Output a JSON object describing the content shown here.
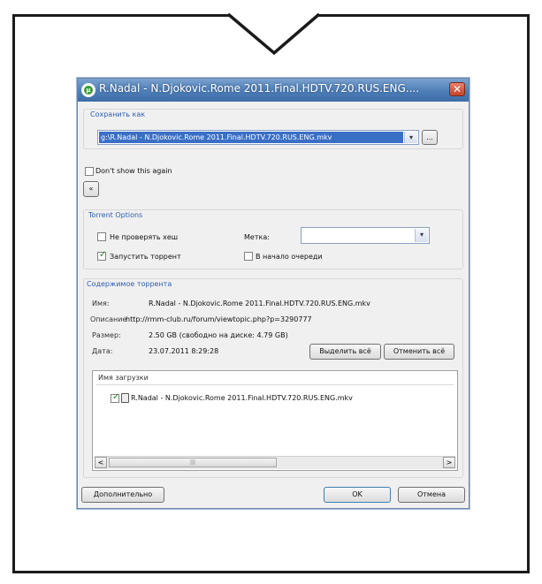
{
  "dialog": {
    "title": "R.Nadal - N.Djokovic.Rome 2011.Final.HDTV.720.RUS.ENG....",
    "close_glyph": "✕",
    "icon_letter": "µ"
  },
  "save_as": {
    "legend": "Сохранить как",
    "path": "g:\\R.Nadal - N.Djokovic.Rome 2011.Final.HDTV.720.RUS.ENG.mkv",
    "dropdown_glyph": "▾",
    "browse_label": "..."
  },
  "dont_show": {
    "label": "Don't show this again",
    "checked": false
  },
  "collapse_glyph": "«",
  "torrent_options": {
    "legend": "Torrent Options",
    "skip_hash": {
      "label": "Не проверять хеш",
      "checked": false
    },
    "start_torrent": {
      "label": "Запустить торрент",
      "checked": true
    },
    "label_field": {
      "label": "Метка:",
      "value": ""
    },
    "queue_top": {
      "label": "В начало очереди",
      "checked": false
    }
  },
  "contents": {
    "legend": "Содержимое торрента",
    "name_label": "Имя:",
    "name_value": "R.Nadal - N.Djokovic.Rome 2011.Final.HDTV.720.RUS.ENG.mkv",
    "desc_label": "Описание",
    "desc_value": "http://rmm-club.ru/forum/viewtopic.php?p=3290777",
    "size_label": "Размер:",
    "size_value": "2.50 GB (свободно на диске: 4.79 GB)",
    "date_label": "Дата:",
    "date_value": "23.07.2011 8:29:28",
    "select_all_label": "Выделить всё",
    "deselect_all_label": "Отменить всё",
    "column_header": "Имя загрузки",
    "files": [
      {
        "name": "R.Nadal - N.Djokovic.Rome 2011.Final.HDTV.720.RUS.ENG.mkv",
        "checked": true
      }
    ],
    "scroll_left": "<",
    "scroll_right": ">",
    "scroll_grip": "|||"
  },
  "footer": {
    "advanced_label": "Дополнительно",
    "ok_label": "OK",
    "cancel_label": "Отмена"
  }
}
